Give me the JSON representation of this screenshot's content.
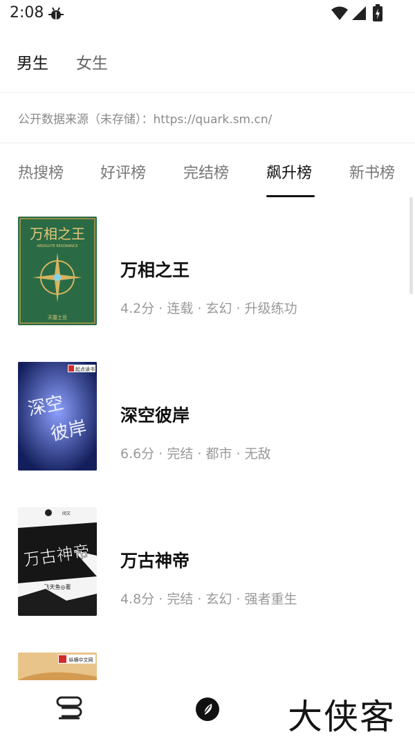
{
  "status_bar": {
    "time": "2:08",
    "icons": [
      "bug-icon",
      "wifi-icon",
      "signal-icon",
      "battery-icon"
    ]
  },
  "gender_tabs": [
    {
      "label": "男生",
      "active": true
    },
    {
      "label": "女生",
      "active": false
    }
  ],
  "source_note": "公开数据来源（未存储）：https://quark.sm.cn/",
  "rank_tabs": [
    {
      "label": "热搜榜",
      "active": false
    },
    {
      "label": "好评榜",
      "active": false
    },
    {
      "label": "完结榜",
      "active": false
    },
    {
      "label": "飙升榜",
      "active": true
    },
    {
      "label": "新书榜",
      "active": false
    }
  ],
  "books": [
    {
      "title": "万相之王",
      "meta": "4.2分 · 连载 · 玄幻 · 升级练功",
      "cover_text": "万相之王",
      "cover_sub": "ABSOLUTE RESONANCE",
      "cover_author": "天蚕土豆",
      "cover_color": "#2a6b45"
    },
    {
      "title": "深空彼岸",
      "meta": "6.6分 · 完结 · 都市 · 无敌",
      "cover_text": "深空彼岸",
      "cover_badge": "起点读书",
      "cover_color": "#1b2a73"
    },
    {
      "title": "万古神帝",
      "meta": "4.8分 · 完结 · 玄幻 · 强者重生",
      "cover_text": "万古神帝",
      "cover_author": "飞天鱼◎著",
      "cover_color": "#f2f2f2"
    },
    {
      "title": "",
      "meta": "",
      "cover_badge": "纵横中文网",
      "cover_color": "#e9c48a"
    }
  ],
  "bottom_nav": {
    "icons": [
      "bookshelf-icon",
      "discover-icon"
    ],
    "watermark": "大侠客"
  },
  "colors": {
    "accent": "#111111",
    "muted": "#999999",
    "divider": "#eeeeee"
  }
}
